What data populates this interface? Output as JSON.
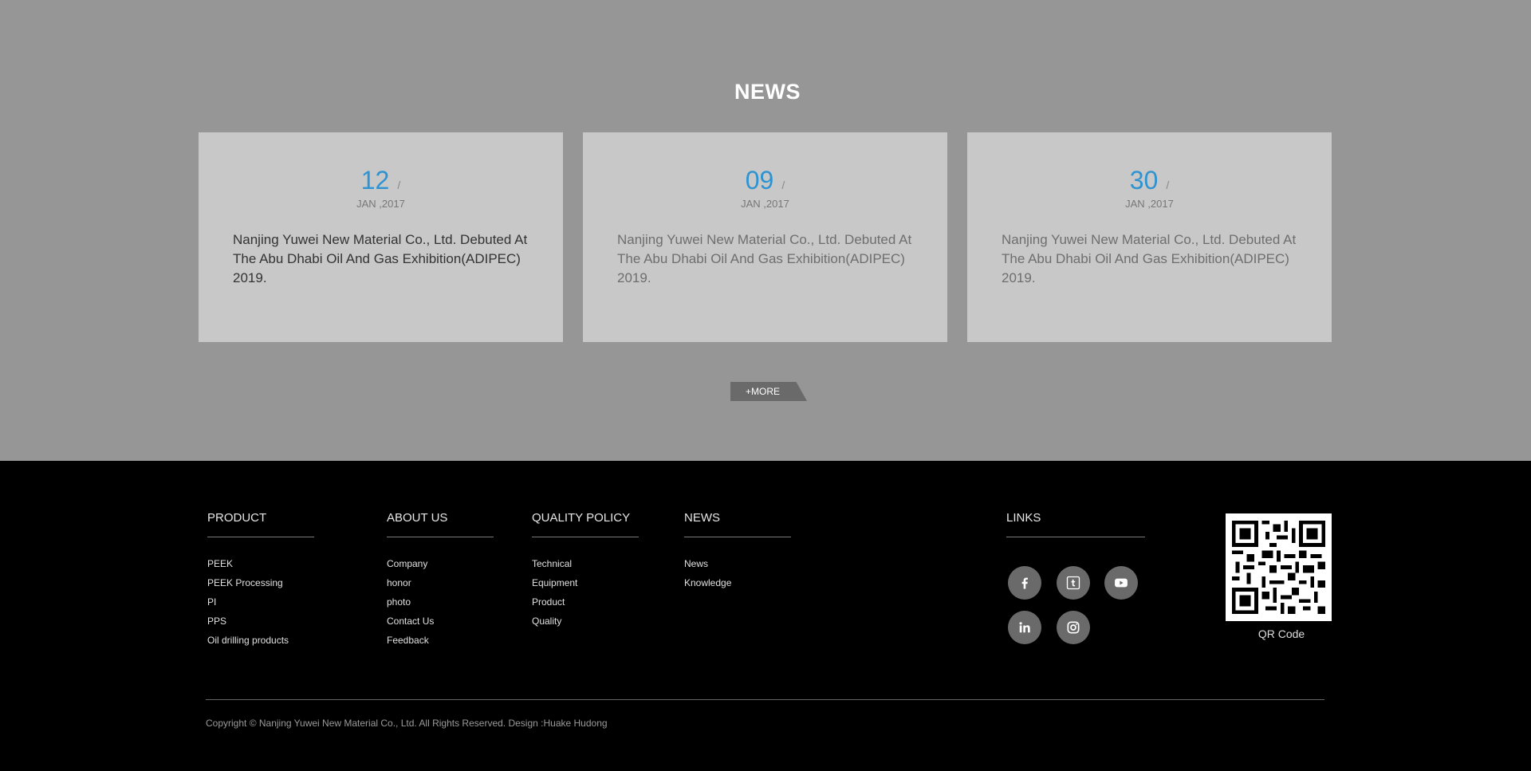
{
  "news": {
    "title": "NEWS",
    "cards": [
      {
        "day": "12",
        "slash": "/",
        "month": "JAN ,2017",
        "summary": "Nanjing Yuwei New Material Co., Ltd. Debuted At The Abu Dhabi Oil And Gas Exhibition(ADIPEC) 2019."
      },
      {
        "day": "09",
        "slash": "/",
        "month": "JAN ,2017",
        "summary": "Nanjing Yuwei New Material Co., Ltd. Debuted At The Abu Dhabi Oil And Gas Exhibition(ADIPEC) 2019."
      },
      {
        "day": "30",
        "slash": "/",
        "month": "JAN ,2017",
        "summary": "Nanjing Yuwei New Material Co., Ltd. Debuted At The Abu Dhabi Oil And Gas Exhibition(ADIPEC) 2019."
      }
    ],
    "more_label": "+MORE"
  },
  "footer": {
    "product": {
      "heading": "PRODUCT",
      "items": [
        "PEEK",
        "PEEK Processing",
        "PI",
        "PPS",
        "Oil drilling products"
      ]
    },
    "about": {
      "heading": "ABOUT US",
      "items": [
        "Company",
        "honor",
        "photo",
        "Contact Us",
        "Feedback"
      ]
    },
    "quality": {
      "heading": "QUALITY POLICY",
      "items": [
        "Technical",
        "Equipment",
        "Product",
        "Quality"
      ]
    },
    "news": {
      "heading": "NEWS",
      "items": [
        "News",
        "Knowledge"
      ]
    },
    "links": {
      "heading": "LINKS",
      "icons": [
        "facebook-icon",
        "tumblr-icon",
        "youtube-icon",
        "linkedin-icon",
        "instagram-icon"
      ]
    },
    "qr_label": "QR Code",
    "copyright": "Copyright © Nanjing Yuwei New Material Co., Ltd. All Rights Reserved.  Design :Huake Hudong"
  },
  "colors": {
    "accent": "#2e93d1",
    "section_bg": "#969696",
    "card_bg": "#c8c8c8",
    "footer_bg": "#000000",
    "icon_bg": "#6a6a6a"
  }
}
